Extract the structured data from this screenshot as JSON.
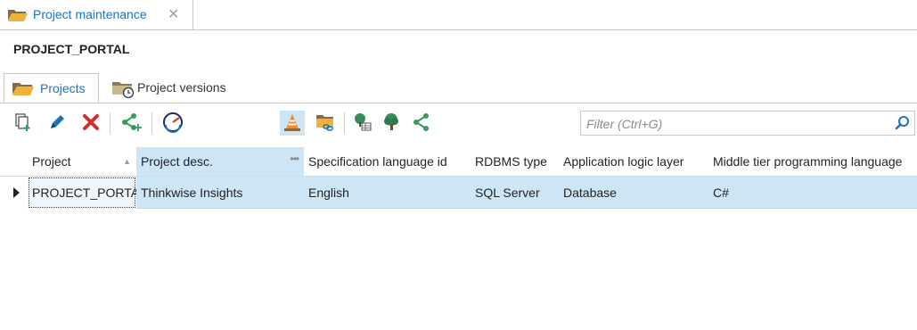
{
  "doc_tab": {
    "label": "Project maintenance",
    "close": "✕"
  },
  "title": "PROJECT_PORTAL",
  "section_tabs": [
    {
      "label": "Projects",
      "active": true
    },
    {
      "label": "Project versions",
      "active": false
    }
  ],
  "toolbar": {
    "buttons": [
      "copy-add-icon",
      "edit-icon",
      "delete-icon",
      "share-add-icon",
      "speed-icon",
      "cone-icon",
      "folder-link-icon",
      "tree-table-icon",
      "tree-icon",
      "share-icon"
    ],
    "filter_placeholder": "Filter (Ctrl+G)",
    "filter_value": ""
  },
  "grid": {
    "columns": [
      "Project",
      "Project desc.",
      "Specification language id",
      "RDBMS type",
      "Application logic layer",
      "Middle tier programming language"
    ],
    "rows": [
      [
        "PROJECT_PORTAL",
        "Thinkwise Insights",
        "English",
        "SQL Server",
        "Database",
        "C#"
      ]
    ]
  },
  "colors": {
    "accent": "#1e73be",
    "selection": "#cde6f7",
    "delete": "#d32f2f",
    "green": "#3a9a5b"
  }
}
